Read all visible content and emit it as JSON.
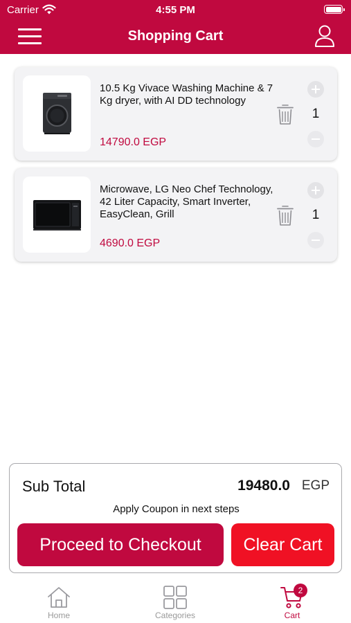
{
  "status_bar": {
    "carrier": "Carrier",
    "time": "4:55 PM"
  },
  "header": {
    "title": "Shopping Cart",
    "menu_icon": "hamburger-menu-icon",
    "profile_icon": "user-profile-icon"
  },
  "cart": {
    "items": [
      {
        "name": "10.5 Kg Vivace Washing Machine & 7 Kg dryer, with AI DD technology",
        "price": "14790.0 EGP",
        "quantity": "1",
        "image_icon": "washing-machine-icon"
      },
      {
        "name": "Microwave, LG Neo Chef Technology, 42 Liter Capacity, Smart Inverter, EasyClean, Grill",
        "price": "4690.0 EGP",
        "quantity": "1",
        "image_icon": "microwave-icon"
      }
    ]
  },
  "summary": {
    "subtotal_label": "Sub Total",
    "subtotal_amount": "19480.0",
    "currency": "EGP",
    "coupon_note": "Apply Coupon in next steps",
    "checkout_label": "Proceed to Checkout",
    "clear_label": "Clear Cart"
  },
  "tab_bar": {
    "home": "Home",
    "categories": "Categories",
    "cart": "Cart",
    "cart_badge": "2"
  },
  "colors": {
    "brand": "#c0093f",
    "clear_button": "#f01124",
    "price_text": "#c0093f",
    "tab_inactive": "#999999"
  }
}
